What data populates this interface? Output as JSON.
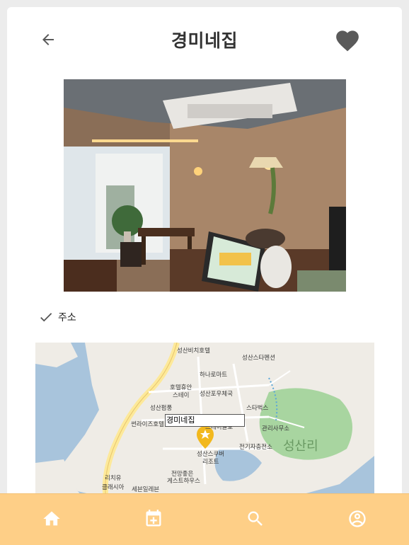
{
  "header": {
    "title": "경미네집",
    "back_icon": "arrow-left-icon",
    "favorite_icon": "heart-icon",
    "icon_color": "#5a5a5a"
  },
  "photo": {
    "description_icon": "restaurant-interior-photo"
  },
  "address": {
    "check_icon": "check-icon",
    "label": "주소"
  },
  "map": {
    "marker_label": "경미네집",
    "place_labels": [
      "성산비치호텔",
      "성산스타펜션",
      "하나로마트",
      "호텔휴안",
      "스테이",
      "성산포우체국",
      "성산펌풍",
      "스타벅스",
      "썬라이즈호텔",
      "스테이글로",
      "관리사무소",
      "성산리",
      "전기자충전소",
      "성산스쿠버",
      "리조트",
      "전망좋은",
      "게스트하우스",
      "리치유",
      "클래시아",
      "세븐일레븐"
    ],
    "colors": {
      "water": "#a8c4dc",
      "land": "#efece6",
      "park": "#a8d5a0",
      "road_major": "#fde99a"
    }
  },
  "bottom_nav": {
    "background": "#fecf87",
    "items": [
      {
        "icon": "home-icon"
      },
      {
        "icon": "calendar-add-icon"
      },
      {
        "icon": "search-icon"
      },
      {
        "icon": "account-icon"
      }
    ]
  }
}
